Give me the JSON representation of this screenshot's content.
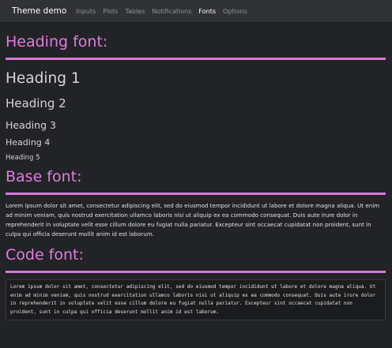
{
  "navbar": {
    "brand": "Theme demo",
    "items": [
      {
        "label": "Inputs"
      },
      {
        "label": "Plots"
      },
      {
        "label": "Tables"
      },
      {
        "label": "Notifications"
      },
      {
        "label": "Fonts"
      },
      {
        "label": "Options"
      }
    ],
    "active_item": "Fonts"
  },
  "sections": {
    "heading": {
      "title": "Heading font:",
      "h1": "Heading 1",
      "h2": "Heading 2",
      "h3": "Heading 3",
      "h4": "Heading 4",
      "h5": "Heading 5"
    },
    "base": {
      "title": "Base font:",
      "text": "Lorem ipsum dolor sit amet, consectetur adipiscing elit, sed do eiusmod tempor incididunt ut labore et dolore magna aliqua. Ut enim ad minim veniam, quis nostrud exercitation ullamco laboris nisi ut aliquip ex ea commodo consequat. Duis aute irure dolor in reprehenderit in voluptate velit esse cillum dolore eu fugiat nulla pariatur. Excepteur sint occaecat cupidatat non proident, sunt in culpa qui officia deserunt mollit anim id est laborum."
    },
    "code": {
      "title": "Code font:",
      "text": "Lorem ipsum dolor sit amet, consectetur adipiscing elit, sed do eiusmod tempor incididunt ut labore et dolore magna aliqua. Ut enim ad minim veniam, quis nostrud exercitation ullamco laboris nisi ut aliquip ex ea commodo consequat. Duis aute irure dolor in reprehenderit in voluptate velit esse cillum dolore eu fugiat nulla pariatur. Excepteur sint occaecat cupidatat non proident, sunt in culpa qui officia deserunt mollit anim id est laborum."
    }
  },
  "colors": {
    "accent": "#d978d9",
    "background": "#222326",
    "navbar": "#303236"
  }
}
